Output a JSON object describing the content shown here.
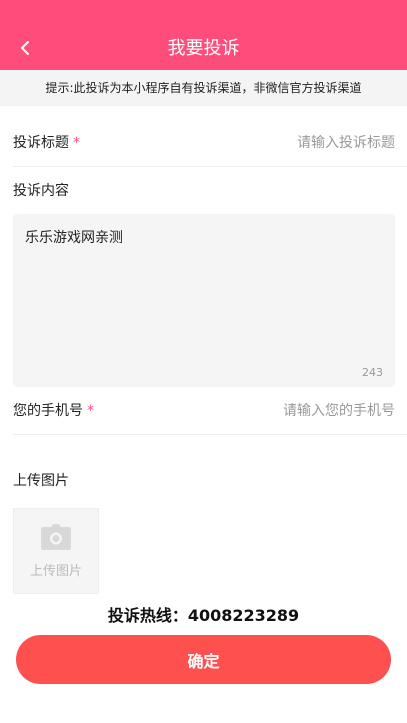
{
  "header": {
    "title": "我要投诉",
    "back_icon": "chevron-left-icon",
    "background_color": "#ff4d7b"
  },
  "notice": {
    "text": "提示:此投诉为本小程序自有投诉渠道，非微信官方投诉渠道"
  },
  "form": {
    "title_field": {
      "label": "投诉标题",
      "required_mark": "*",
      "placeholder": "请输入投诉标题",
      "value": ""
    },
    "content_field": {
      "label": "投诉内容",
      "value": "乐乐游戏网亲测",
      "remaining_count": "243"
    },
    "phone_field": {
      "label": "您的手机号",
      "required_mark": "*",
      "placeholder": "请输入您的手机号",
      "value": ""
    },
    "upload": {
      "label": "上传图片",
      "button_text": "上传图片",
      "icon": "camera-icon"
    }
  },
  "hotline": {
    "text": "投诉热线：4008223289"
  },
  "confirm": {
    "label": "确定",
    "color": "#ff5050"
  }
}
